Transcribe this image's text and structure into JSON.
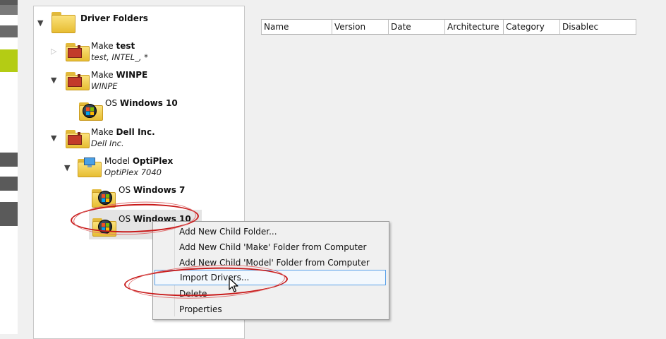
{
  "tree": {
    "root_label": "Driver Folders",
    "nodes": [
      {
        "prefix": "Make",
        "name": "test",
        "sub": "test, INTEL_, *",
        "expanded": false,
        "icon": "factory-icon"
      },
      {
        "prefix": "Make",
        "name": "WINPE",
        "sub": "WINPE",
        "expanded": true,
        "icon": "factory-icon"
      },
      {
        "prefix": "OS",
        "name": "Windows 10",
        "sub": "",
        "icon": "windows-logo-icon"
      },
      {
        "prefix": "Make",
        "name": "Dell Inc.",
        "sub": "Dell Inc.",
        "expanded": true,
        "icon": "factory-icon"
      },
      {
        "prefix": "Model",
        "name": "OptiPlex",
        "sub": "OptiPlex 7040",
        "expanded": true,
        "icon": "computer-icon"
      },
      {
        "prefix": "OS",
        "name": "Windows 7",
        "sub": "",
        "icon": "windows-logo-icon"
      },
      {
        "prefix": "OS",
        "name": "Windows 10",
        "sub": "",
        "icon": "windows-logo-icon",
        "selected": true
      }
    ]
  },
  "list": {
    "columns": [
      "Name",
      "Version",
      "Date",
      "Architecture",
      "Category",
      "Disablec"
    ]
  },
  "context_menu": {
    "items": [
      "Add New Child Folder...",
      "Add New Child 'Make' Folder from Computer",
      "Add New Child 'Model' Folder from Computer",
      "Import Drivers...",
      "Delete",
      "Properties"
    ],
    "highlighted_index": 3
  },
  "colors": {
    "annotation": "#c81a1a",
    "menu_highlight_border": "#5aa0e8",
    "left_strip_accent": "#b4cc14"
  }
}
